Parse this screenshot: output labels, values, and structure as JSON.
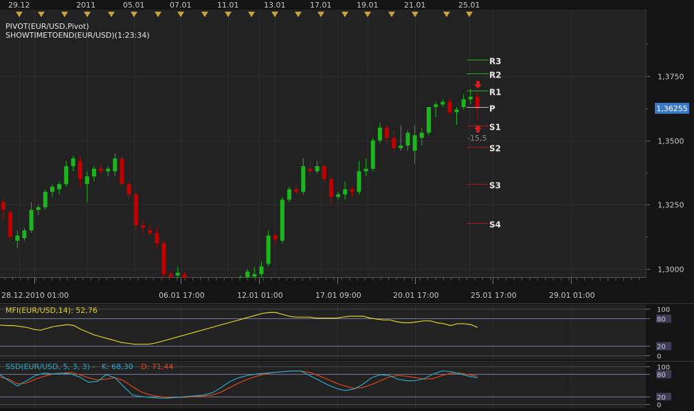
{
  "top_dates": [
    "29.12",
    "2011",
    "05.01",
    "07.01",
    "11.01",
    "13.01",
    "17.01",
    "19.01",
    "21.01",
    "25.01"
  ],
  "bottom_dates": [
    "28.12.2010 01:00",
    "06.01 17:00",
    "12.01 01:00",
    "17.01 09:00",
    "20.01 17:00",
    "25.01 17:00",
    "29.01 01:00"
  ],
  "studies": {
    "pivot": "PIVOT(EUR/USD,Pivot)",
    "timer": "SHOWTIMETOEND(EUR/USD)(1:23:34)"
  },
  "price_badge": "1,36255",
  "pivot_note": "-15,5",
  "colors": {
    "up": "#1db51d",
    "down": "#c00000",
    "resistance": "#22b022",
    "support": "#b01818",
    "mfi": "#e0d030",
    "stoch_k": "#2aa8c8",
    "stoch_d": "#e04818",
    "badge": "#3a78c8"
  },
  "chart_data": [
    {
      "type": "candlestick",
      "title": "",
      "symbol": "EUR/USD",
      "ylim": [
        1.2925,
        1.39
      ],
      "yticks": [
        "1,3000",
        "1,3250",
        "1,3500",
        "1,3750"
      ],
      "pivots": [
        {
          "name": "R3",
          "value": 1.3815
        },
        {
          "name": "R2",
          "value": 1.376
        },
        {
          "name": "R1",
          "value": 1.3695
        },
        {
          "name": "P",
          "value": 1.363
        },
        {
          "name": "S1",
          "value": 1.3557
        },
        {
          "name": "S2",
          "value": 1.3475
        },
        {
          "name": "S3",
          "value": 1.333
        },
        {
          "name": "S4",
          "value": 1.318
        }
      ],
      "candles": [
        [
          1.326,
          1.3275,
          1.319,
          1.323
        ],
        [
          1.322,
          1.323,
          1.311,
          1.3125
        ],
        [
          1.311,
          1.315,
          1.308,
          1.313
        ],
        [
          1.312,
          1.316,
          1.311,
          1.315
        ],
        [
          1.315,
          1.326,
          1.314,
          1.323
        ],
        [
          1.323,
          1.325,
          1.321,
          1.324
        ],
        [
          1.324,
          1.331,
          1.323,
          1.33
        ],
        [
          1.33,
          1.333,
          1.328,
          1.332
        ],
        [
          1.331,
          1.334,
          1.329,
          1.333
        ],
        [
          1.333,
          1.342,
          1.332,
          1.34
        ],
        [
          1.34,
          1.344,
          1.338,
          1.343
        ],
        [
          1.342,
          1.344,
          1.332,
          1.335
        ],
        [
          1.333,
          1.338,
          1.326,
          1.336
        ],
        [
          1.336,
          1.34,
          1.334,
          1.339
        ],
        [
          1.339,
          1.341,
          1.337,
          1.338
        ],
        [
          1.338,
          1.34,
          1.336,
          1.339
        ],
        [
          1.338,
          1.345,
          1.336,
          1.343
        ],
        [
          1.343,
          1.344,
          1.332,
          1.333
        ],
        [
          1.333,
          1.334,
          1.327,
          1.329
        ],
        [
          1.329,
          1.33,
          1.315,
          1.317
        ],
        [
          1.317,
          1.319,
          1.314,
          1.316
        ],
        [
          1.315,
          1.317,
          1.313,
          1.314
        ],
        [
          1.314,
          1.316,
          1.308,
          1.31
        ],
        [
          1.31,
          1.311,
          1.297,
          1.298
        ],
        [
          1.298,
          1.299,
          1.295,
          1.297
        ],
        [
          1.2975,
          1.301,
          1.296,
          1.2985
        ],
        [
          1.298,
          1.299,
          1.295,
          1.296
        ],
        [
          1.296,
          1.297,
          1.2935,
          1.2945
        ],
        [
          1.2945,
          1.2955,
          1.2935,
          1.2948
        ],
        [
          1.2948,
          1.2958,
          1.2938,
          1.2942
        ],
        [
          1.2942,
          1.2948,
          1.2932,
          1.2938
        ],
        [
          1.293,
          1.295,
          1.292,
          1.294
        ],
        [
          1.294,
          1.297,
          1.2935,
          1.2955
        ],
        [
          1.2955,
          1.297,
          1.294,
          1.295
        ],
        [
          1.295,
          1.2975,
          1.294,
          1.2968
        ],
        [
          1.2968,
          1.3,
          1.2958,
          1.299
        ],
        [
          1.297,
          1.301,
          1.296,
          1.298
        ],
        [
          1.298,
          1.303,
          1.296,
          1.301
        ],
        [
          1.302,
          1.315,
          1.301,
          1.313
        ],
        [
          1.313,
          1.314,
          1.31,
          1.3115
        ],
        [
          1.311,
          1.328,
          1.31,
          1.327
        ],
        [
          1.327,
          1.332,
          1.326,
          1.331
        ],
        [
          1.331,
          1.333,
          1.329,
          1.33
        ],
        [
          1.33,
          1.343,
          1.329,
          1.34
        ],
        [
          1.339,
          1.342,
          1.336,
          1.338
        ],
        [
          1.338,
          1.342,
          1.337,
          1.34
        ],
        [
          1.34,
          1.341,
          1.333,
          1.335
        ],
        [
          1.335,
          1.336,
          1.325,
          1.328
        ],
        [
          1.328,
          1.33,
          1.327,
          1.329
        ],
        [
          1.329,
          1.334,
          1.327,
          1.331
        ],
        [
          1.331,
          1.332,
          1.328,
          1.33
        ],
        [
          1.33,
          1.342,
          1.329,
          1.338
        ],
        [
          1.338,
          1.343,
          1.336,
          1.339
        ],
        [
          1.339,
          1.351,
          1.338,
          1.35
        ],
        [
          1.35,
          1.357,
          1.349,
          1.355
        ],
        [
          1.355,
          1.356,
          1.349,
          1.351
        ],
        [
          1.351,
          1.354,
          1.345,
          1.347
        ],
        [
          1.347,
          1.356,
          1.346,
          1.348
        ],
        [
          1.348,
          1.354,
          1.346,
          1.353
        ],
        [
          1.346,
          1.356,
          1.341,
          1.352
        ],
        [
          1.351,
          1.355,
          1.348,
          1.353
        ],
        [
          1.353,
          1.363,
          1.352,
          1.363
        ],
        [
          1.363,
          1.365,
          1.359,
          1.364
        ],
        [
          1.364,
          1.366,
          1.363,
          1.365
        ],
        [
          1.365,
          1.366,
          1.36,
          1.361
        ],
        [
          1.361,
          1.363,
          1.356,
          1.362
        ],
        [
          1.363,
          1.368,
          1.362,
          1.366
        ],
        [
          1.366,
          1.37,
          1.364,
          1.367
        ],
        [
          1.367,
          1.369,
          1.358,
          1.3625
        ]
      ]
    },
    {
      "type": "line",
      "title": "MFI(EUR/USD,14): 52,76",
      "ylim": [
        0,
        100
      ],
      "levels": [
        100,
        80,
        20,
        0
      ],
      "series": [
        {
          "name": "MFI",
          "values": [
            65,
            64,
            64,
            62,
            60,
            56,
            54,
            58,
            62,
            64,
            66,
            64,
            56,
            50,
            44,
            40,
            36,
            32,
            28,
            26,
            24,
            24,
            24,
            26,
            30,
            34,
            38,
            42,
            46,
            50,
            54,
            58,
            62,
            66,
            70,
            74,
            78,
            82,
            86,
            90,
            92,
            92,
            88,
            84,
            82,
            82,
            82,
            80,
            80,
            80,
            80,
            82,
            84,
            84,
            84,
            80,
            78,
            76,
            76,
            72,
            70,
            70,
            72,
            74,
            74,
            70,
            68,
            64,
            68,
            68,
            66,
            60
          ]
        }
      ]
    },
    {
      "type": "line",
      "title": "SSD(EUR/USD, 5, 3, 3) -",
      "ylim": [
        0,
        100
      ],
      "levels": [
        100,
        80,
        20,
        0
      ],
      "series": [
        {
          "name": "K: 68,30",
          "values": [
            78,
            62,
            48,
            62,
            76,
            82,
            80,
            82,
            80,
            72,
            58,
            60,
            78,
            70,
            46,
            24,
            20,
            18,
            16,
            16,
            18,
            20,
            22,
            24,
            30,
            44,
            60,
            70,
            76,
            80,
            82,
            84,
            86,
            88,
            88,
            76,
            64,
            52,
            42,
            36,
            40,
            52,
            70,
            78,
            76,
            66,
            62,
            62,
            68,
            80,
            88,
            86,
            80,
            74,
            70
          ]
        },
        {
          "name": "D: 71,44",
          "values": [
            72,
            66,
            54,
            56,
            66,
            74,
            80,
            82,
            84,
            78,
            70,
            64,
            66,
            70,
            62,
            46,
            32,
            24,
            20,
            18,
            18,
            18,
            20,
            22,
            24,
            32,
            44,
            56,
            66,
            74,
            80,
            84,
            86,
            88,
            88,
            84,
            76,
            66,
            56,
            48,
            42,
            44,
            52,
            62,
            72,
            76,
            74,
            70,
            66,
            68,
            76,
            82,
            82,
            78,
            74
          ]
        }
      ]
    }
  ]
}
